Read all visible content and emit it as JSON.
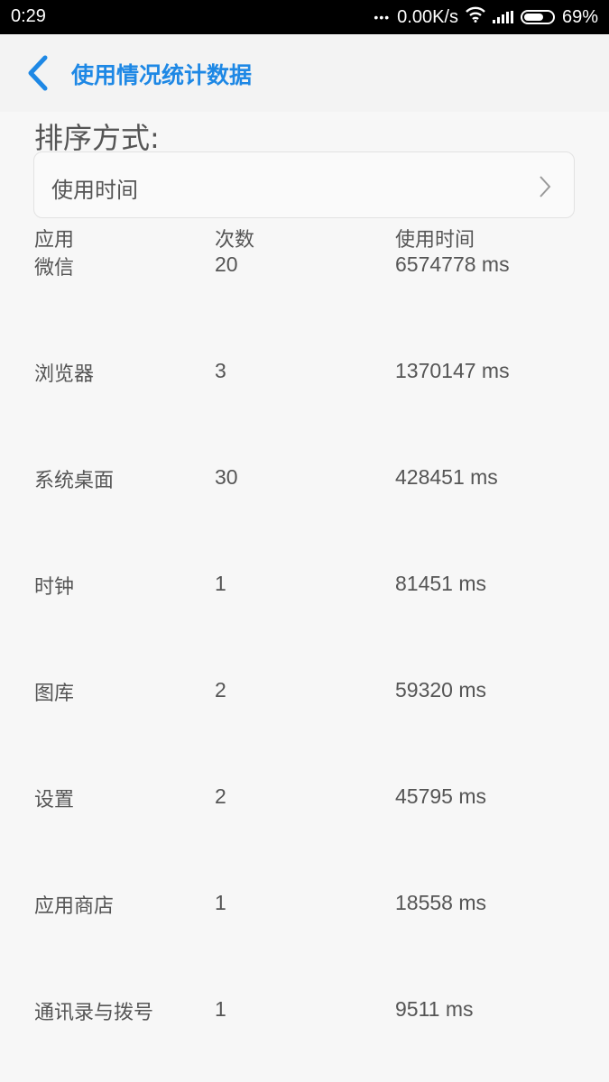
{
  "status_bar": {
    "time": "0:29",
    "dots": "•••",
    "net_speed": "0.00K/s",
    "battery": "69%",
    "battery_level": 0.69
  },
  "header": {
    "title": "使用情况统计数据"
  },
  "sort": {
    "label": "排序方式:",
    "value": "使用时间"
  },
  "table": {
    "headers": [
      "应用",
      "次数",
      "使用时间"
    ],
    "rows": [
      {
        "app": "微信",
        "count": "20",
        "time": "6574778 ms"
      },
      {
        "app": "浏览器",
        "count": "3",
        "time": "1370147 ms"
      },
      {
        "app": "系统桌面",
        "count": "30",
        "time": "428451 ms"
      },
      {
        "app": "时钟",
        "count": "1",
        "time": "81451 ms"
      },
      {
        "app": "图库",
        "count": "2",
        "time": "59320 ms"
      },
      {
        "app": "设置",
        "count": "2",
        "time": "45795 ms"
      },
      {
        "app": "应用商店",
        "count": "1",
        "time": "18558 ms"
      },
      {
        "app": "通讯录与拨号",
        "count": "1",
        "time": "9511 ms"
      }
    ]
  },
  "colors": {
    "accent": "#1e88e5",
    "background": "#f7f7f7",
    "text": "#555555"
  }
}
